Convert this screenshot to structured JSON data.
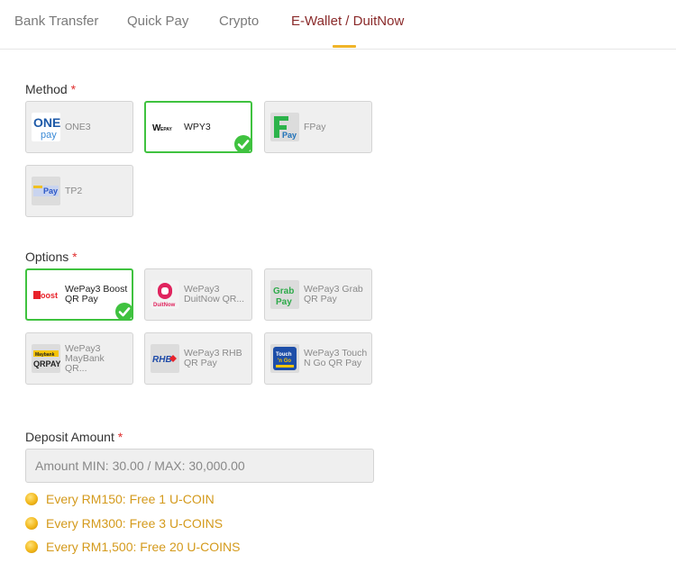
{
  "tabs": [
    {
      "label": "Bank Transfer",
      "active": false
    },
    {
      "label": "Quick Pay",
      "active": false
    },
    {
      "label": "Crypto",
      "active": false
    },
    {
      "label": "E-Wallet / DuitNow",
      "active": true
    }
  ],
  "method": {
    "label": "Method",
    "required_mark": "*",
    "items": [
      {
        "label": "ONE3",
        "logo_text": "ONE pay",
        "icon": "onepay-logo-icon",
        "selected": false
      },
      {
        "label": "WPY3",
        "logo_text": "WEPAY",
        "icon": "wepay-logo-icon",
        "selected": true
      },
      {
        "label": "FPay",
        "logo_text": "Pay",
        "icon": "fpay-logo-icon",
        "selected": false
      },
      {
        "label": "TP2",
        "logo_text": "Pay",
        "icon": "tp2-logo-icon",
        "selected": false
      }
    ]
  },
  "options": {
    "label": "Options",
    "required_mark": "*",
    "items": [
      {
        "label": "WePay3 Boost QR Pay",
        "logo_text": "Boost",
        "icon": "boost-logo-icon",
        "selected": true
      },
      {
        "label": "WePay3 DuitNow QR...",
        "logo_text": "DuitNow",
        "icon": "duitnow-logo-icon",
        "selected": false
      },
      {
        "label": "WePay3 Grab QR Pay",
        "logo_text": "Grab Pay",
        "icon": "grabpay-logo-icon",
        "selected": false
      },
      {
        "label": "WePay3 MayBank QR...",
        "logo_text": "QRPAY",
        "icon": "maybank-qrpay-logo-icon",
        "selected": false
      },
      {
        "label": "WePay3 RHB QR Pay",
        "logo_text": "RHB",
        "icon": "rhb-logo-icon",
        "selected": false
      },
      {
        "label": "WePay3 Touch N Go QR Pay",
        "logo_text": "Touch n Go",
        "icon": "touchngo-logo-icon",
        "selected": false
      }
    ]
  },
  "deposit": {
    "label": "Deposit Amount",
    "required_mark": "*",
    "value": "",
    "placeholder": "Amount MIN: 30.00 / MAX: 30,000.00"
  },
  "promos": [
    {
      "text": "Every RM150: Free 1 U-COIN",
      "icon": "coin-icon"
    },
    {
      "text": "Every RM300: Free 3 U-COINS",
      "icon": "coin-icon"
    },
    {
      "text": "Every RM1,500: Free 20 U-COINS",
      "icon": "coin-icon"
    }
  ],
  "colors": {
    "active_tab_text": "#8a2a2a",
    "tab_underline": "#f0b429",
    "selected_border": "#3fc23f",
    "required": "#e03030",
    "promo_text": "#d49a1c"
  }
}
